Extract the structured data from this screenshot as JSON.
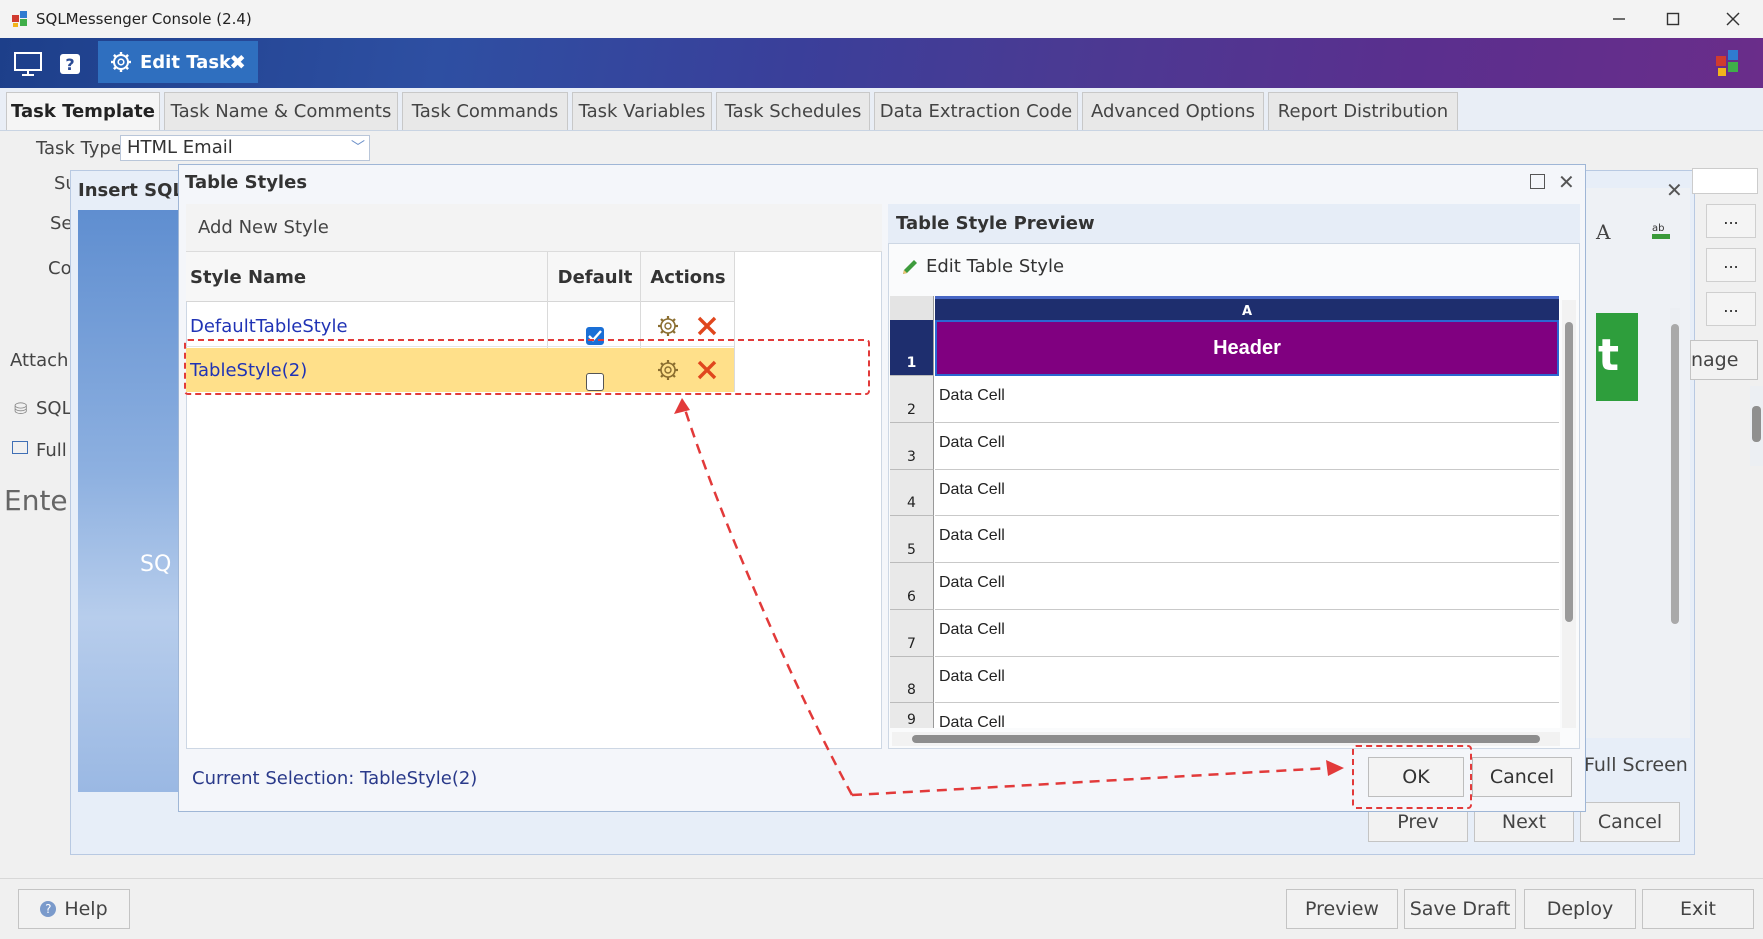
{
  "window": {
    "title": "SQLMessenger Console (2.4)"
  },
  "header": {
    "edit_tab_label": "Edit Task"
  },
  "tabs": [
    {
      "label": "Task Template",
      "active": true
    },
    {
      "label": "Task Name & Comments"
    },
    {
      "label": "Task Commands"
    },
    {
      "label": "Task Variables"
    },
    {
      "label": "Task Schedules"
    },
    {
      "label": "Data Extraction Code"
    },
    {
      "label": "Advanced Options"
    },
    {
      "label": "Report Distribution"
    }
  ],
  "form": {
    "task_type_label": "Task Type",
    "task_type_value": "HTML Email",
    "partial_labels": [
      "Su",
      "Se",
      "Co",
      "Attachm",
      "SQL",
      "Full",
      "Enter"
    ]
  },
  "insert_dialog": {
    "title": "Insert SQL T",
    "side_text": "SQ",
    "partial_right_text": "nage",
    "green_text": "t",
    "full_screen": "Full Screen",
    "prev": "Prev",
    "next": "Next",
    "cancel": "Cancel",
    "ellipsis": "..."
  },
  "table_styles_dialog": {
    "title": "Table Styles",
    "add_new_style": "Add New Style",
    "columns": [
      "Style Name",
      "Default",
      "Actions"
    ],
    "rows": [
      {
        "name": "DefaultTableStyle",
        "default": true
      },
      {
        "name": "TableStyle(2)",
        "default": false,
        "selected": true
      }
    ],
    "current_selection": "Current Selection: TableStyle(2)",
    "ok": "OK",
    "cancel": "Cancel"
  },
  "preview": {
    "title": "Table Style Preview",
    "edit_button": "Edit Table Style",
    "column_letter": "A",
    "header_text": "Header",
    "row_numbers": [
      "1",
      "2",
      "3",
      "4",
      "5",
      "6",
      "7",
      "8",
      "9"
    ],
    "data_cells": [
      "Data Cell",
      "Data Cell",
      "Data Cell",
      "Data Cell",
      "Data Cell",
      "Data Cell",
      "Data Cell",
      "Data Cell"
    ],
    "header_color": "#800080"
  },
  "bottom": {
    "help": "Help",
    "preview": "Preview",
    "save_draft": "Save Draft",
    "deploy": "Deploy",
    "exit": "Exit"
  }
}
